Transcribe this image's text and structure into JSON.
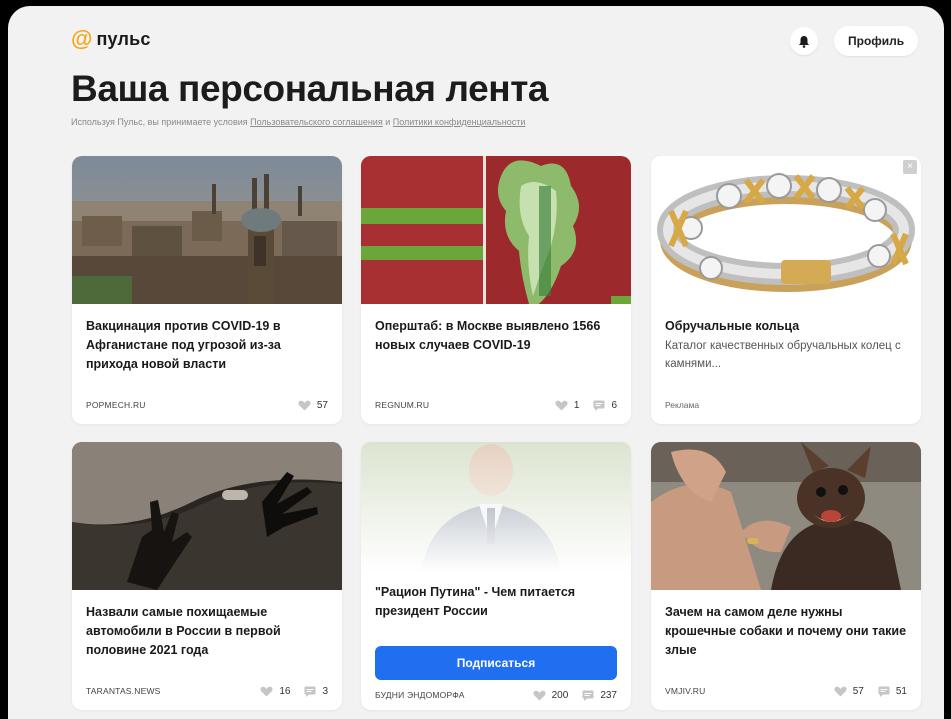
{
  "header": {
    "logo_symbol": "@",
    "logo_text": "пульс",
    "profile_label": "Профиль",
    "bell_icon": "bell-icon"
  },
  "page": {
    "title": "Ваша персональная лента",
    "terms_prefix": "Используя Пульс, вы принимаете условия ",
    "terms_link1": "Пользовательского соглашения",
    "terms_and": " и ",
    "terms_link2": "Политики конфиденциальности"
  },
  "colors": {
    "accent_orange": "#f3a81c",
    "button_blue": "#1f6ff0",
    "background": "#f2f2f3"
  },
  "cards": [
    {
      "title": "Вакцинация против COVID-19 в Афганистане под угрозой из-за прихода новой власти",
      "source": "POPMECH.RU",
      "likes": "57"
    },
    {
      "title": "Оперштаб: в Москве выявлено 1566 новых случаев COVID-19",
      "source": "REGNUM.RU",
      "likes": "1",
      "comments": "6"
    },
    {
      "title": "Обручальные кольца",
      "description": "Каталог качественных обручальных колец с камнями...",
      "source": "Реклама",
      "close": "×"
    },
    {
      "title": "Назвали самые похищаемые автомобили в России в первой половине 2021 года",
      "source": "TARANTAS.NEWS",
      "likes": "16",
      "comments": "3"
    },
    {
      "title": "\"Рацион Путина\" - Чем питается президент России",
      "subscribe_label": "Подписаться",
      "source": "БУДНИ ЭНДОМОРФА",
      "likes": "200",
      "comments": "237"
    },
    {
      "title": "Зачем на самом деле нужны крошечные собаки и почему они такие злые",
      "source": "VMJIV.RU",
      "likes": "57",
      "comments": "51"
    }
  ]
}
